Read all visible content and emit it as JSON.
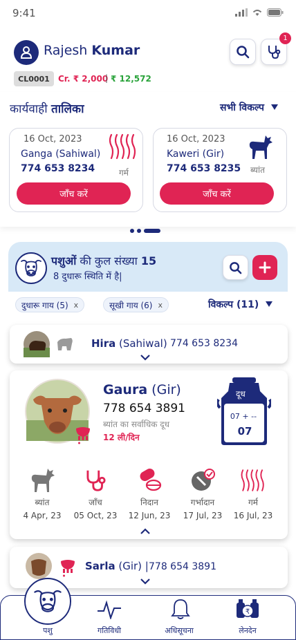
{
  "status_bar": {
    "time": "9:41"
  },
  "header": {
    "first_name": "Rajesh",
    "last_name": "Kumar",
    "notification_count": "1",
    "customer_id": "CL0001",
    "credit": "Cr. ₹ 2,000",
    "separator": "|",
    "balance": "₹ 12,572"
  },
  "actions": {
    "title_part1": "कार्यवाही",
    "title_part2": "तालिका",
    "all_options": "सभी विकल्प",
    "cards": [
      {
        "date": "16 Oct, 2023",
        "name": "Ganga (Sahiwal)",
        "phone": "774 653 8234",
        "status": "गर्म",
        "button": "जाँच करें"
      },
      {
        "date": "16 Oct, 2023",
        "name": "Kaweri (Gir)",
        "phone": "774 653 8235",
        "status": "ब्यांत",
        "button": "जाँच करें"
      }
    ]
  },
  "herd": {
    "total_part1": "पशुओं",
    "total_part2": " की कुल संख्या ",
    "total_count": "15",
    "milch_text": "8 दुधारू स्थिति में है|",
    "filters": [
      {
        "label": "दुधारू गाय (5)",
        "remove": "x"
      },
      {
        "label": "सूखी गाय (6)",
        "remove": "x"
      }
    ],
    "options": "विकल्प (11)",
    "animals": {
      "hira": {
        "name": "Hira",
        "breed": " (Sahiwal)",
        "phone": "774 653 8234"
      },
      "gaura": {
        "name": "Gaura",
        "breed": " (Gir)",
        "phone": "778 654 3891",
        "milk_label": "ब्यांत का सर्वाधिक दूध",
        "milk_value": "12 ली/दिन",
        "can_label": "दूध",
        "can_top": "07 + --",
        "can_value": "07",
        "stats": [
          {
            "icon": "calf-icon",
            "label": "ब्यांत",
            "date": "4 Apr, 23"
          },
          {
            "icon": "stethoscope-icon",
            "label": "जाँच",
            "date": "05 Oct, 23"
          },
          {
            "icon": "medicine-icon",
            "label": "निदान",
            "date": "12 Jun, 23"
          },
          {
            "icon": "insemination-icon",
            "label": "गर्भादान",
            "date": "17 Jul, 23"
          },
          {
            "icon": "heat-icon",
            "label": "गर्म",
            "date": "16 Jul, 23"
          }
        ]
      },
      "sarla": {
        "name": "Sarla",
        "breed": " (Gir)",
        "separator": " | ",
        "phone": "778 654 3891"
      }
    }
  },
  "bottom_nav": [
    {
      "label": "पशु",
      "icon": "cow-icon"
    },
    {
      "label": "गतिविधी",
      "icon": "activity-icon"
    },
    {
      "label": "अधिसूचना",
      "icon": "bell-icon"
    },
    {
      "label": "लेनदेन",
      "icon": "milk-transaction-icon"
    }
  ],
  "colors": {
    "primary": "#1d2a7a",
    "accent": "#e02454",
    "success": "#2aa33b",
    "herd_panel": "#d8e9f7"
  }
}
